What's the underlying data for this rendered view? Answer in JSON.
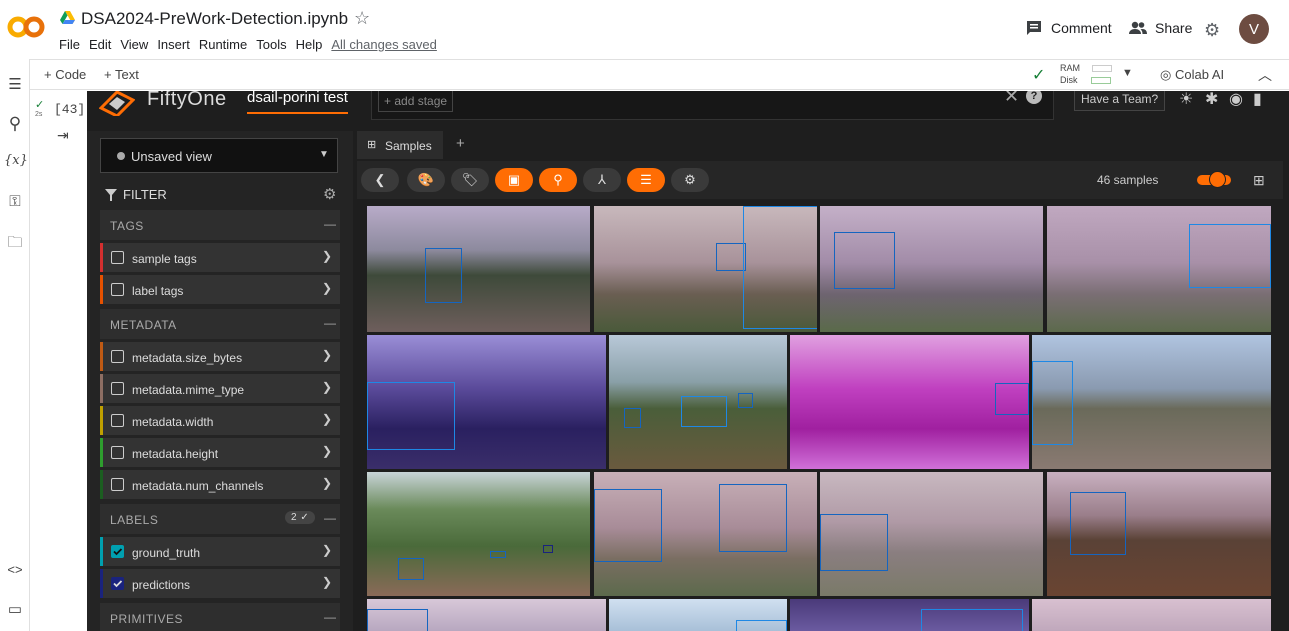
{
  "colab": {
    "title": "DSA2024-PreWork-Detection.ipynb",
    "menu": [
      "File",
      "Edit",
      "View",
      "Insert",
      "Runtime",
      "Tools",
      "Help"
    ],
    "save_status": "All changes saved",
    "comment_label": "Comment",
    "share_label": "Share",
    "avatar_letter": "V",
    "toolbar": {
      "code_label": "+ Code",
      "text_label": "+ Text",
      "ram_label": "RAM",
      "disk_label": "Disk",
      "colab_ai_label": "Colab AI"
    },
    "cell": {
      "exec_count": "[43]",
      "exec_time": "2s"
    },
    "rail_icons": [
      "toc-icon",
      "search-icon",
      "variables-icon",
      "key-icon",
      "folder-icon",
      "code-snippets-icon",
      "terminal-icon"
    ]
  },
  "fiftyone": {
    "brand": "FiftyOne",
    "dataset": "dsail-porini test",
    "add_stage": "+ add stage",
    "team_button": "Have a Team?",
    "view_select": "Unsaved view",
    "filter_label": "FILTER",
    "groups": {
      "tags": "TAGS",
      "metadata": "METADATA",
      "labels": "LABELS",
      "primitives": "PRIMITIVES"
    },
    "labels_badge": "2 ✓",
    "rows": {
      "sample_tags": "sample tags",
      "label_tags": "label tags",
      "size_bytes": "metadata.size_bytes",
      "mime_type": "metadata.mime_type",
      "width": "metadata.width",
      "height": "metadata.height",
      "num_channels": "metadata.num_channels",
      "ground_truth": "ground_truth",
      "predictions": "predictions"
    },
    "row_colors": {
      "sample_tags": "#d32f2f",
      "label_tags": "#e65100",
      "size_bytes": "#bf5a14",
      "mime_type": "#8d6e63",
      "width": "#c0a000",
      "height": "#2e9e2e",
      "num_channels": "#1b5e20",
      "ground_truth": "#00a0b0",
      "predictions": "#1a237e"
    },
    "tab": "Samples",
    "sample_count": "46 samples",
    "accent": "#ff6d04"
  }
}
